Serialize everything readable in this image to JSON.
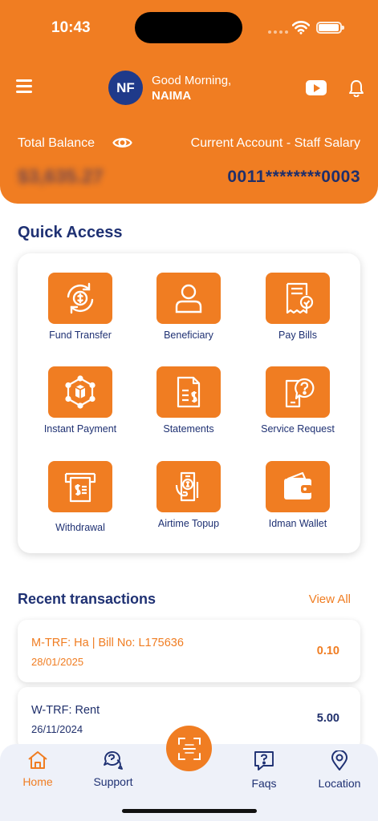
{
  "status_bar": {
    "time": "10:43"
  },
  "header": {
    "avatar_initials": "NF",
    "greeting": "Good Morning,",
    "user_name": "NAIMA",
    "total_balance_label": "Total Balance",
    "balance_value": "$3,635.27",
    "account_name": "Current Account - Staff Salary",
    "account_number": "0011********0003"
  },
  "quick_access": {
    "title": "Quick Access",
    "items": [
      {
        "label": "Fund Transfer",
        "icon": "fund-transfer-icon"
      },
      {
        "label": "Beneficiary",
        "icon": "person-icon"
      },
      {
        "label": "Pay Bills",
        "icon": "bill-icon"
      },
      {
        "label": "Instant Payment",
        "icon": "instant-payment-icon"
      },
      {
        "label": "Statements",
        "icon": "statement-icon"
      },
      {
        "label": "Service Request",
        "icon": "service-request-icon"
      },
      {
        "label": "Withdrawal",
        "icon": "withdrawal-icon"
      },
      {
        "label": "Airtime Topup",
        "icon": "airtime-topup-icon"
      },
      {
        "label": "Idman Wallet",
        "icon": "wallet-icon"
      }
    ]
  },
  "recent": {
    "title": "Recent transactions",
    "view_all": "View All",
    "transactions": [
      {
        "title": "M-TRF: Ha | Bill No: L175636",
        "date": "28/01/2025",
        "amount": "0.10"
      },
      {
        "title": "W-TRF: Rent",
        "date": "26/11/2024",
        "amount": "5.00"
      }
    ]
  },
  "bottom_nav": {
    "items": [
      {
        "label": "Home"
      },
      {
        "label": "Support"
      },
      {
        "label": "Faqs"
      },
      {
        "label": "Location"
      }
    ]
  },
  "colors": {
    "brand_orange": "#f07d22",
    "navy": "#1f2f6b",
    "avatar_blue": "#1f3a8a"
  }
}
